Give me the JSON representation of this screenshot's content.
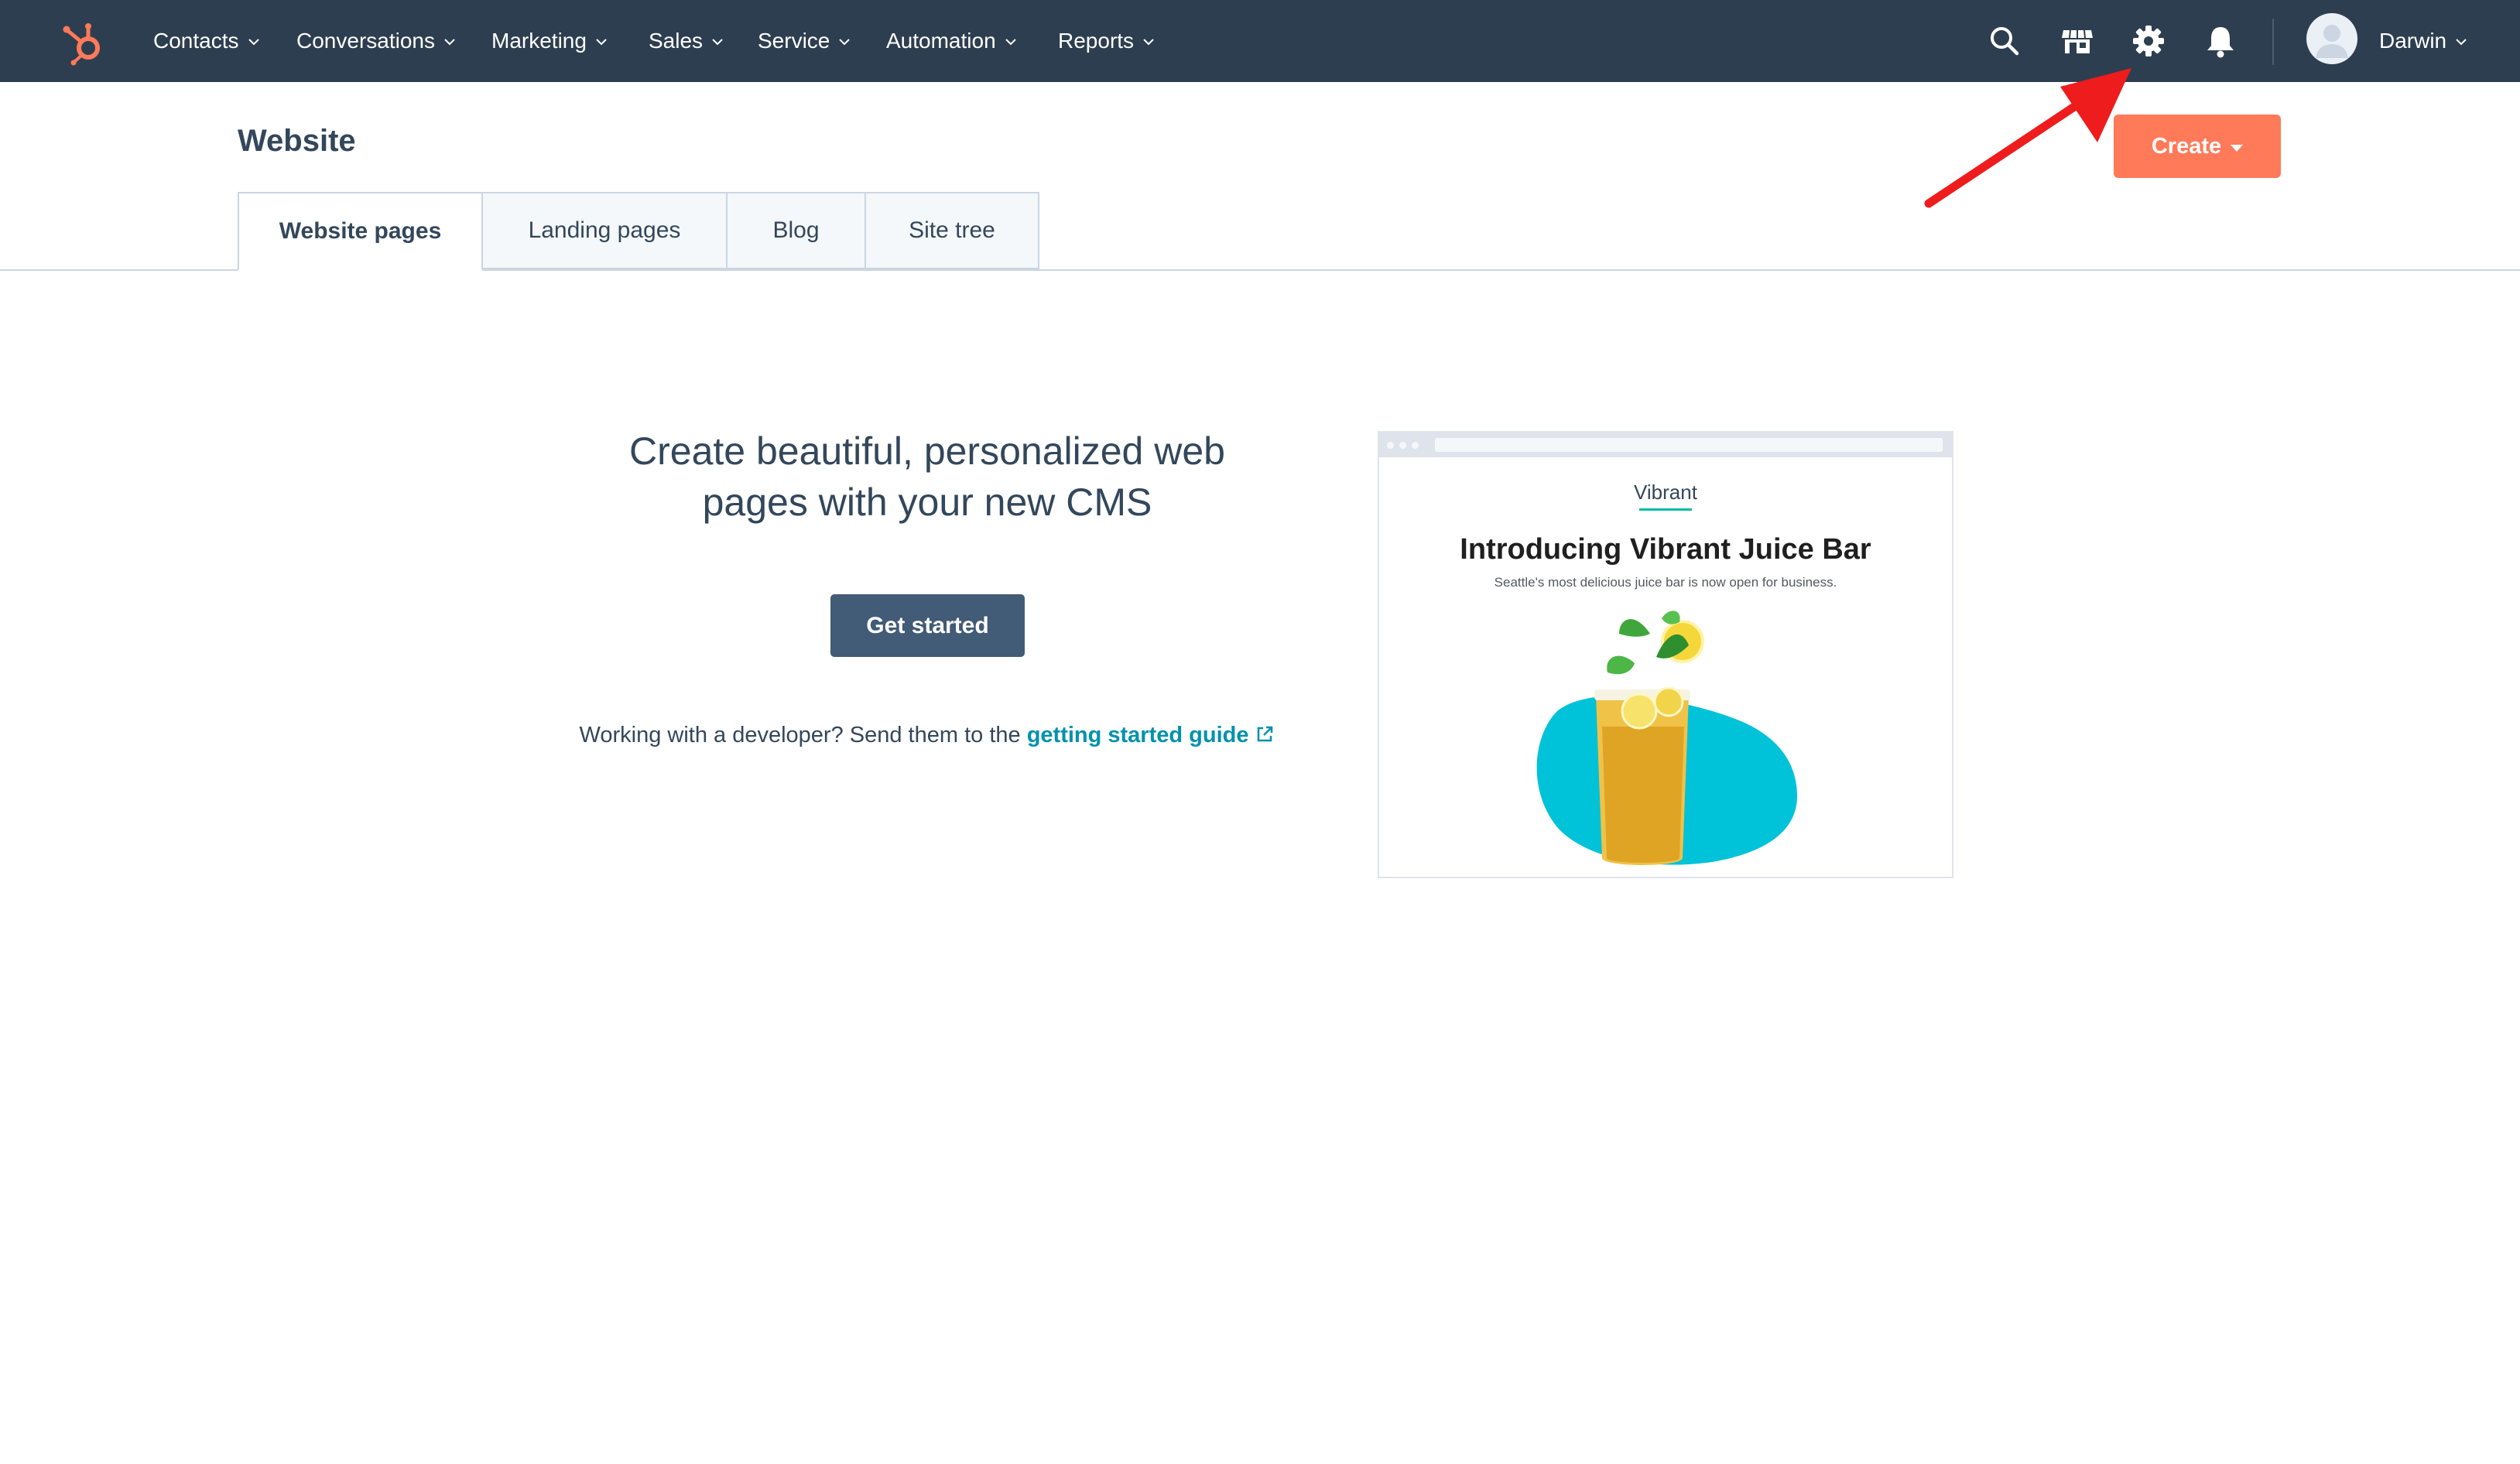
{
  "nav": {
    "items": [
      {
        "label": "Contacts"
      },
      {
        "label": "Conversations"
      },
      {
        "label": "Marketing"
      },
      {
        "label": "Sales"
      },
      {
        "label": "Service"
      },
      {
        "label": "Automation"
      },
      {
        "label": "Reports"
      }
    ],
    "icons": [
      "search-icon",
      "marketplace-icon",
      "settings-gear-icon",
      "notifications-bell-icon"
    ],
    "account_name": "Darwin"
  },
  "page": {
    "title": "Website",
    "create_label": "Create",
    "tabs": [
      {
        "label": "Website pages",
        "active": true
      },
      {
        "label": "Landing pages",
        "active": false
      },
      {
        "label": "Blog",
        "active": false
      },
      {
        "label": "Site tree",
        "active": false
      }
    ]
  },
  "empty_state": {
    "heading_line1": "Create beautiful, personalized web",
    "heading_line2": "pages with your new CMS",
    "cta_label": "Get started",
    "dev_text": "Working with a developer? Send them to the ",
    "dev_link": "getting started guide"
  },
  "preview": {
    "brand": "Vibrant",
    "title": "Introducing Vibrant Juice Bar",
    "subtitle": "Seattle's most delicious juice bar is now open for business."
  },
  "colors": {
    "nav_bg": "#2d3e50",
    "accent_orange": "#ff7a59",
    "primary_button": "#425b76",
    "link": "#0091ae",
    "annotation_arrow": "#ee1c1c"
  }
}
